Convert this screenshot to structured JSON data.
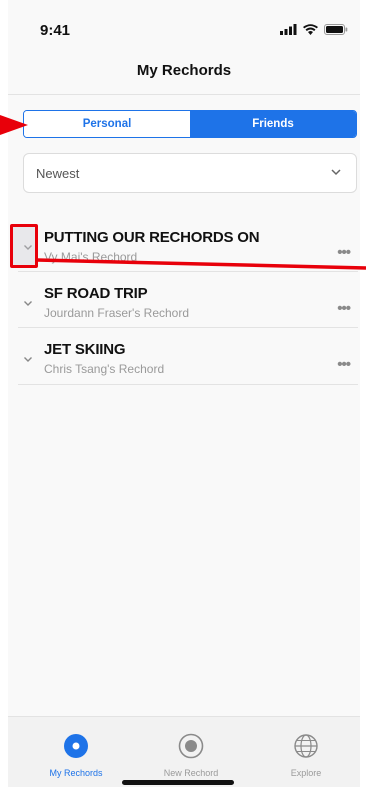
{
  "status_bar": {
    "time": "9:41"
  },
  "header": {
    "title": "My Rechords"
  },
  "segment": {
    "personal_label": "Personal",
    "friends_label": "Friends"
  },
  "sort": {
    "value": "Newest"
  },
  "rechords": [
    {
      "title": "PUTTING OUR RECHORDS ON",
      "owner": "Vy Mai's Rechord",
      "more": "•••"
    },
    {
      "title": "SF ROAD TRIP",
      "owner": "Jourdann Fraser's Rechord",
      "more": "•••"
    },
    {
      "title": "JET SKIING",
      "owner": "Chris Tsang's Rechord",
      "more": "•••"
    }
  ],
  "tabbar": [
    {
      "label": "My Rechords",
      "icon": "record-dot-icon",
      "active": true
    },
    {
      "label": "New Rechord",
      "icon": "record-button-icon",
      "active": false
    },
    {
      "label": "Explore",
      "icon": "globe-icon",
      "active": false
    }
  ],
  "colors": {
    "accent": "#1e73e8",
    "annotation": "#e8000a"
  }
}
